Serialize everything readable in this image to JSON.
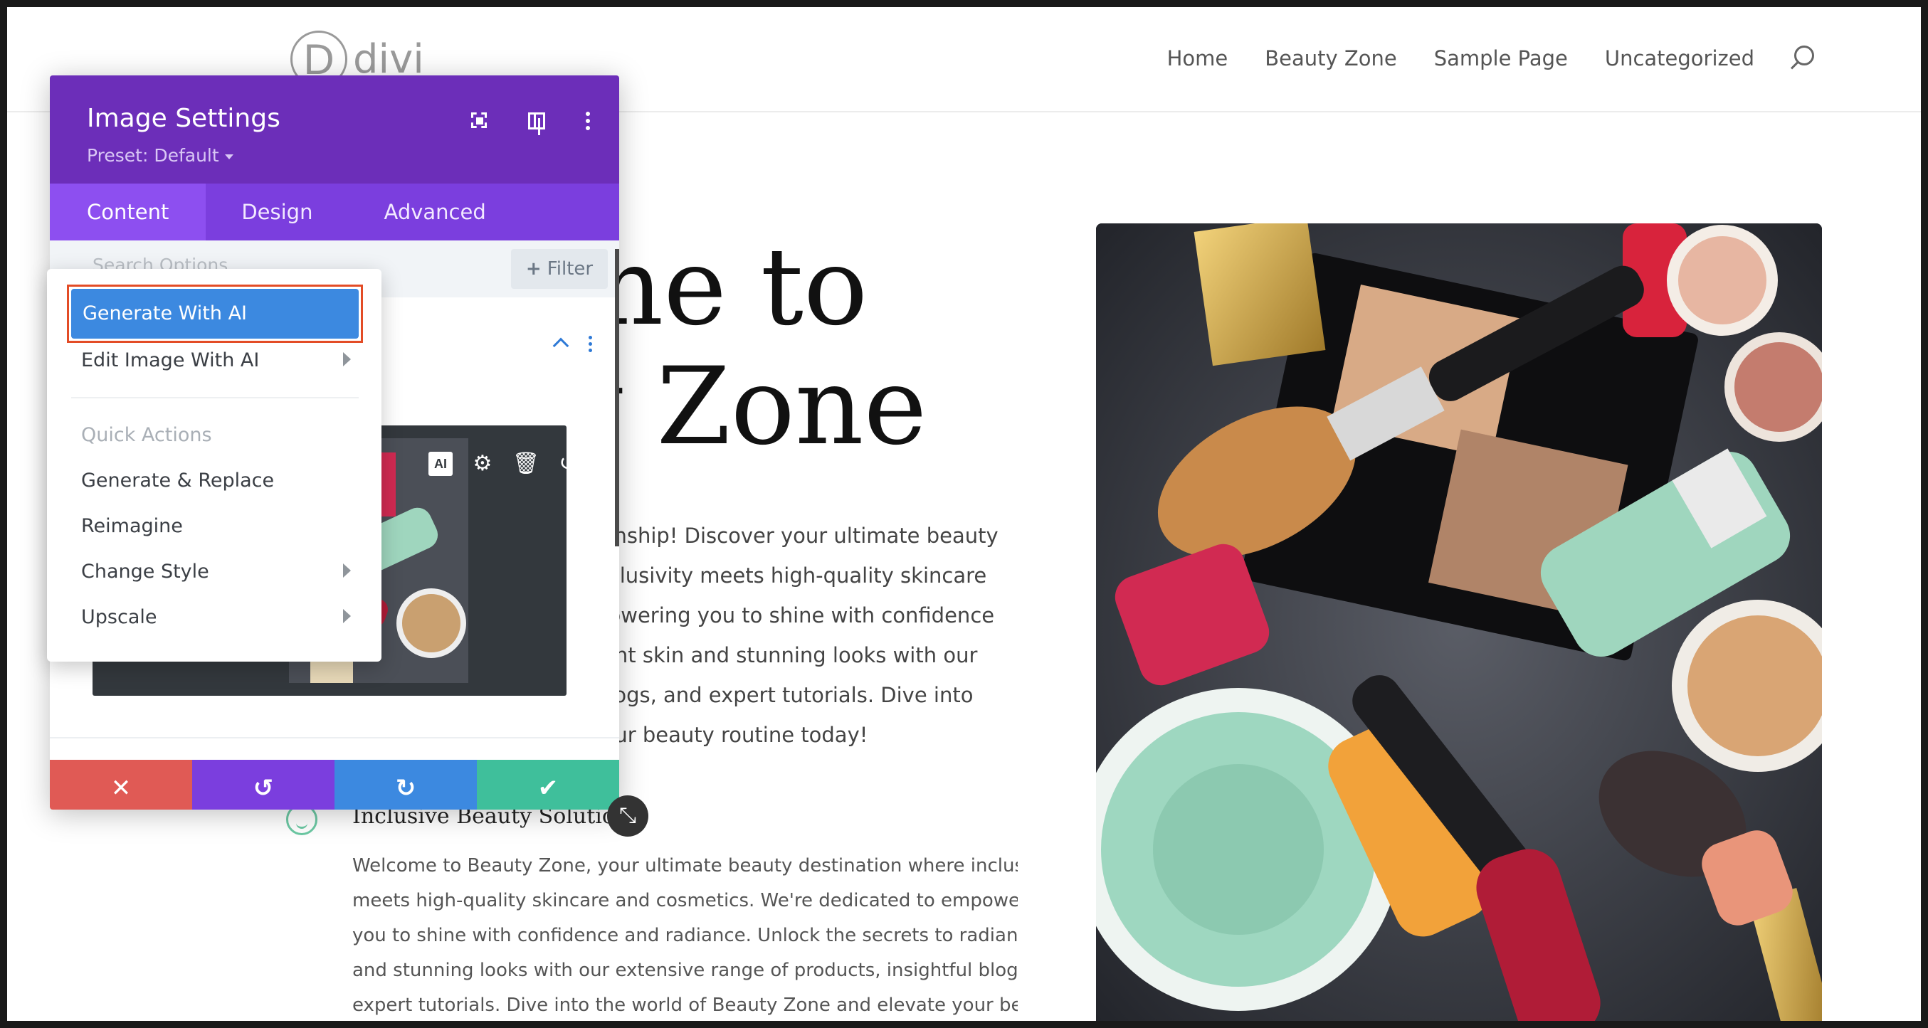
{
  "site": {
    "logo_letter": "D",
    "logo_text": "divi",
    "nav": [
      "Home",
      "Beauty Zone",
      "Sample Page",
      "Uncategorized"
    ],
    "search_icon": "search-icon"
  },
  "hero": {
    "title_lines": [
      "me to",
      "y Zone"
    ],
    "paragraph_lines": [
      "mpionship! Discover your ultimate beauty",
      "re inclusivity meets high-quality skincare",
      "empowering you to shine with confidence",
      "radiant skin and stunning looks with our",
      "ful blogs, and expert tutorials. Dive into",
      "te your beauty routine today!"
    ]
  },
  "feature": {
    "title": "Inclusive Beauty Solutio",
    "body_lines": [
      "Welcome to Beauty Zone, your ultimate beauty destination where inclusivity",
      "meets high-quality skincare and cosmetics. We're dedicated to empowering",
      "you to shine with confidence and radiance. Unlock the secrets to radiant skin",
      "and stunning looks with our extensive range of products, insightful blogs, and",
      "expert tutorials. Dive into the world of Beauty Zone and elevate your beauty"
    ]
  },
  "panel": {
    "title": "Image Settings",
    "preset": "Preset: Default",
    "tabs": [
      "Content",
      "Design",
      "Advanced"
    ],
    "search_placeholder": "Search Options",
    "filter_label": "Filter",
    "ai_badge": "AI",
    "colors": {
      "header": "#6c2eb9",
      "tabs": "#7b3ede",
      "cancel": "#e05a55",
      "undo": "#7b3ede",
      "redo": "#3c89e0",
      "save": "#3fbf9b"
    }
  },
  "ai_menu": {
    "generate": "Generate With AI",
    "edit": "Edit Image With AI",
    "heading": "Quick Actions",
    "items": [
      "Generate & Replace",
      "Reimagine",
      "Change Style",
      "Upscale"
    ],
    "highlight_color": "#e34c26"
  }
}
